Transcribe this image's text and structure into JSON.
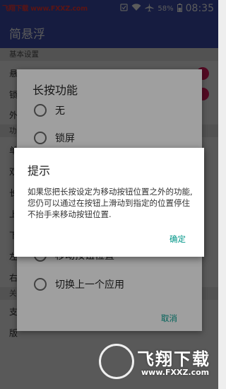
{
  "status_bar": {
    "watermark": "飞翔下载 www.FXXZ.com",
    "battery": "58%",
    "time": "08:35",
    "icons": [
      "notification-icon",
      "wifi-icon",
      "airplane-icon",
      "battery-icon"
    ]
  },
  "app_bar": {
    "title": "简悬浮"
  },
  "settings": {
    "sections": [
      {
        "header": "基本设置"
      },
      {
        "header": "功"
      },
      {
        "header": "关"
      }
    ],
    "rows": [
      "悬",
      "锁",
      "外",
      "单",
      "双",
      "长",
      "上",
      "下",
      "左",
      "右",
      "支",
      "版"
    ],
    "toggle_color": "#e91e63"
  },
  "long_press_dialog": {
    "title": "长按功能",
    "options": [
      {
        "label": "无",
        "selected": false
      },
      {
        "label": "锁屏",
        "selected": false
      },
      {
        "label": "移动按钮位置",
        "selected": false
      },
      {
        "label": "切换上一个应用",
        "selected": false
      }
    ],
    "cancel_label": "取消"
  },
  "hint_dialog": {
    "title": "提示",
    "message": "如果您把长按设定为移动按钮位置之外的功能,您仍可以通过在按钮上滑动到指定的位置停住不抬手来移动按钮位置.",
    "ok_label": "确定"
  },
  "watermark": {
    "brand": "飞翔下载",
    "url": "www.FXXZ.com"
  },
  "colors": {
    "primary": "#3f51b5",
    "accent": "#e91e63",
    "button_text": "#009688"
  }
}
